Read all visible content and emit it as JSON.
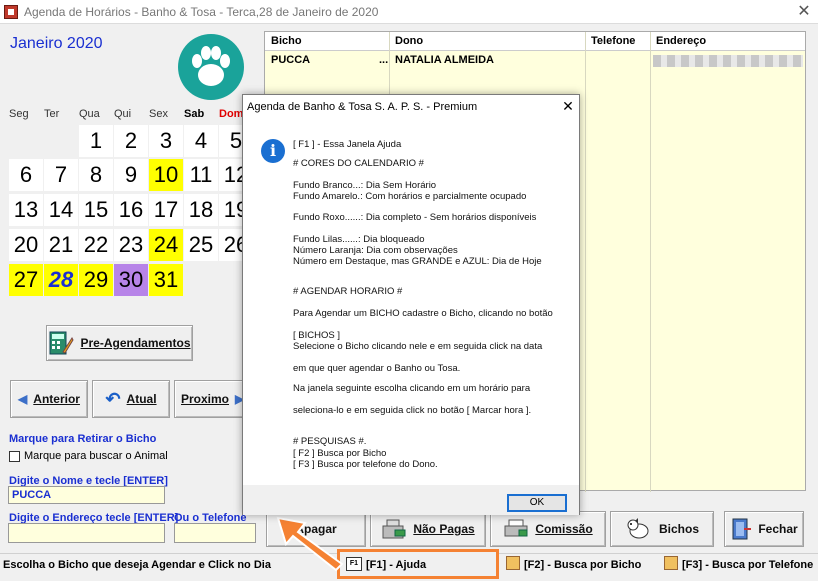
{
  "window": {
    "title": "Agenda de Horários - Banho & Tosa - Terca,28 de Janeiro de 2020",
    "close_glyph": "✕"
  },
  "calendar": {
    "month": "Janeiro 2020",
    "weekdays": [
      "Seg",
      "Ter",
      "Qua",
      "Qui",
      "Sex",
      "Sab",
      "Dom"
    ],
    "weekday_colors": [
      "#333333",
      "#333333",
      "#333333",
      "#333333",
      "#333333",
      "#000000",
      "#e00000"
    ],
    "days": [
      [
        "",
        "",
        "1",
        "2",
        "3",
        "4",
        "5"
      ],
      [
        "6",
        "7",
        "8",
        "9",
        "10",
        "11",
        "12"
      ],
      [
        "13",
        "14",
        "15",
        "16",
        "17",
        "18",
        "19"
      ],
      [
        "20",
        "21",
        "22",
        "23",
        "24",
        "25",
        "26"
      ],
      [
        "27",
        "28",
        "29",
        "30",
        "31",
        "",
        ""
      ]
    ],
    "day_styles": [
      [
        "none",
        "none",
        "white",
        "white",
        "white",
        "white",
        "white"
      ],
      [
        "white",
        "white",
        "white",
        "white",
        "yellow",
        "white",
        "white"
      ],
      [
        "white",
        "white",
        "white",
        "white",
        "white",
        "white",
        "white"
      ],
      [
        "white",
        "white",
        "white",
        "white",
        "yellow",
        "white",
        "white"
      ],
      [
        "yellow",
        "today",
        "yellow",
        "purple",
        "yellow",
        "none",
        "none"
      ]
    ],
    "colors": {
      "yellow": "#ffff00",
      "purple": "#b784e8",
      "today_text": "#1a2fd1"
    }
  },
  "buttons": {
    "pre_agendamentos": "Pre-Agendamentos",
    "anterior": "Anterior",
    "atual": "Atual",
    "proximo": "Proximo",
    "apagar": "Apagar",
    "nao_pagas": "Não Pagas",
    "comissao": "Comissão",
    "bichos": "Bichos",
    "fechar": "Fechar"
  },
  "search": {
    "retirar_label": "Marque para Retirar o Bicho",
    "checkbox_label": "Marque para buscar o Animal",
    "nome_label": "Digite o Nome e tecle [ENTER]",
    "nome_value": "PUCCA",
    "endereco_label": "Digite o Endereço tecle [ENTER]",
    "telefone_label": "Ou o Telefone",
    "endereco_value": ""
  },
  "grid": {
    "columns": [
      "Bicho",
      "Dono",
      "Telefone",
      "Endereço"
    ],
    "rows": [
      {
        "bicho": "PUCCA",
        "ellipsis": "...",
        "dono": "NATALIA ALMEIDA",
        "telefone": ""
      }
    ]
  },
  "status": {
    "hint": "Escolha o Bicho que deseja Agendar e Click no Dia",
    "f1": "[F1] - Ajuda",
    "f2": "[F2] - Busca por Bicho",
    "f3": "[F3] - Busca por Telefone",
    "f1_badge": "F1"
  },
  "dialog": {
    "title": "Agenda de Banho & Tosa S. A. P. S. - Premium",
    "close_glyph": "✕",
    "info_glyph": "i",
    "lines": [
      "[ F1 ] - Essa Janela Ajuda",
      "# CORES DO CALENDARIO #",
      "Fundo Branco...: Dia Sem Horário",
      "Fundo Amarelo.: Com horários e parcialmente ocupado",
      "Fundo Roxo......: Dia completo - Sem horários disponíveis",
      "Fundo Lilas......: Dia bloqueado",
      "Número Laranja: Dia com observações",
      "Número em Destaque, mas GRANDE e AZUL: Dia de Hoje",
      "# AGENDAR HORARIO #",
      "Para Agendar um BICHO cadastre o Bicho, clicando no botão",
      "[ BICHOS ]",
      "Selecione o Bicho clicando nele e em seguida click na data",
      "em que quer agendar o Banho ou Tosa.",
      "Na janela seguinte escolha clicando em um horário para",
      "seleciona-lo e em seguida click no botão [ Marcar hora ].",
      "# PESQUISAS #.",
      "[ F2 ] Busca por Bicho",
      "[ F3 ] Busca por telefone do Dono."
    ],
    "ok": "OK"
  },
  "colors": {
    "accent_blue": "#1a2fd1",
    "highlight_orange": "#f58233",
    "grid_bg": "#ffffdd"
  }
}
